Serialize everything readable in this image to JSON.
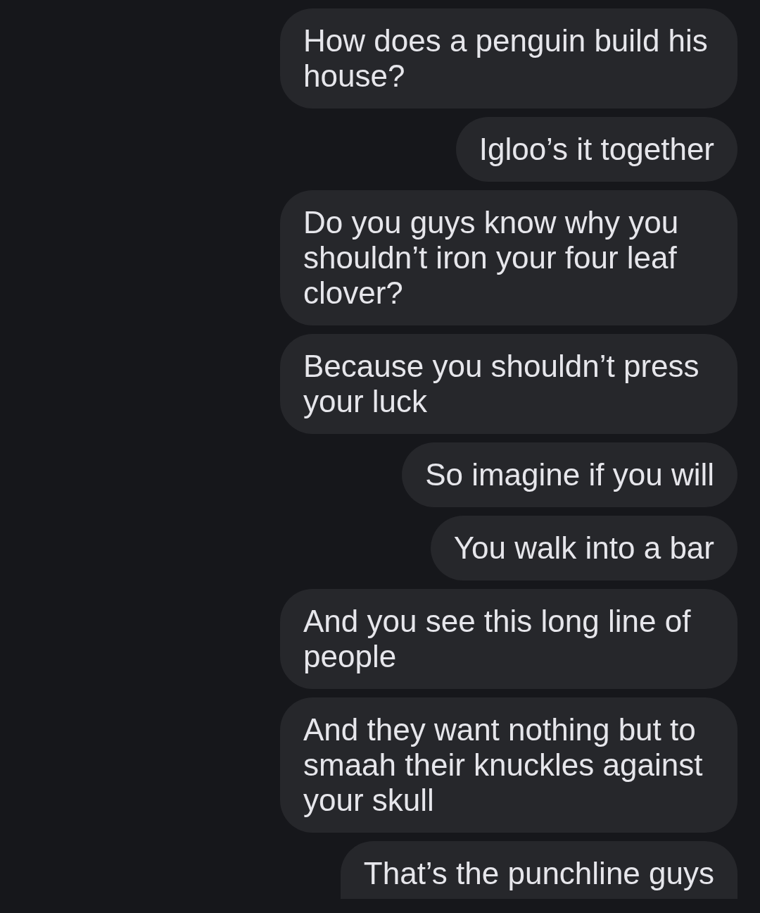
{
  "messages": [
    {
      "text": "How does a penguin build his house?"
    },
    {
      "text": "Igloo’s it together"
    },
    {
      "text": "Do you guys know why you shouldn’t iron your four leaf clover?"
    },
    {
      "text": "Because you shouldn’t press your luck"
    },
    {
      "text": "So imagine if you will"
    },
    {
      "text": "You walk into a bar"
    },
    {
      "text": "And you see this long line of people"
    },
    {
      "text": "And they want nothing but to smaah their knuckles against your skull"
    },
    {
      "text": "That’s the punchline guys"
    }
  ]
}
